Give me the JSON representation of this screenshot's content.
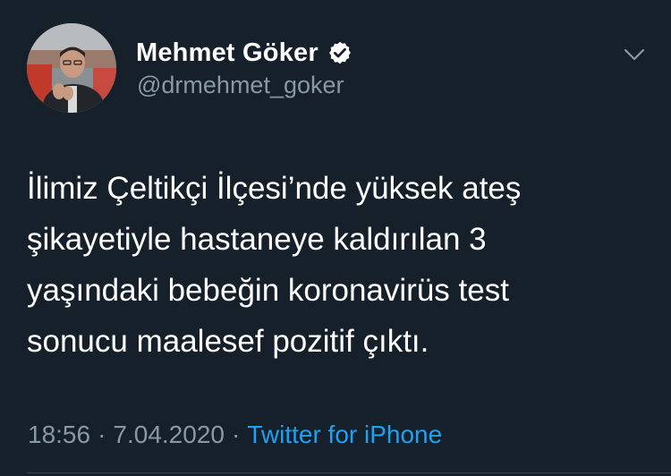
{
  "author": {
    "display_name": "Mehmet Göker",
    "handle": "@drmehmet_goker",
    "verified": true,
    "avatar_icon": "profile-photo"
  },
  "tweet": {
    "text": "İlimiz Çeltikçi İlçesi’nde yüksek ateş\nşikayetiyle hastaneye kaldırılan 3\nyaşındaki bebeğin koronavirüs test\nsonucu maalesef pozitif çıktı.",
    "time": "18:56",
    "date": "7.04.2020",
    "separator": "·",
    "source": "Twitter for iPhone"
  },
  "icons": {
    "verified": "verified-badge-icon",
    "menu": "chevron-down-icon"
  },
  "colors": {
    "background": "#15202b",
    "secondary_text": "#8899a6",
    "link": "#1da1f2",
    "divider": "#38444d"
  }
}
